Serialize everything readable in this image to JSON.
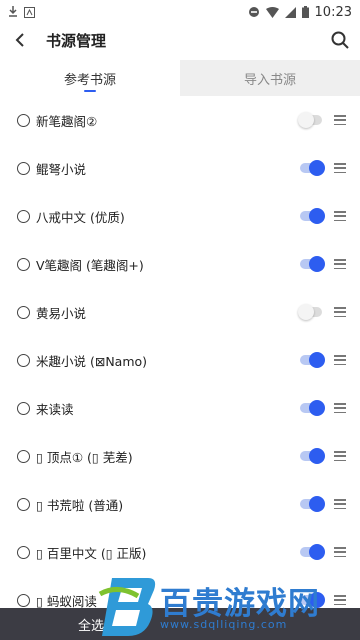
{
  "status_bar": {
    "time": "10:23"
  },
  "header": {
    "title": "书源管理"
  },
  "tabs": [
    {
      "label": "参考书源",
      "active": true
    },
    {
      "label": "导入书源",
      "active": false
    }
  ],
  "sources": [
    {
      "name": "新笔趣阁②",
      "enabled": false
    },
    {
      "name": "鲲弩小说",
      "enabled": true
    },
    {
      "name": "八戒中文 (优质)",
      "enabled": true
    },
    {
      "name": "V笔趣阁 (笔趣阁+)",
      "enabled": true
    },
    {
      "name": "黄易小说",
      "enabled": false
    },
    {
      "name": "米趣小说 (⊠Namo)",
      "enabled": true
    },
    {
      "name": "来读读",
      "enabled": true
    },
    {
      "name": "▯ 顶点① (▯ 芜差)",
      "enabled": true
    },
    {
      "name": "▯ 书荒啦 (普通)",
      "enabled": true
    },
    {
      "name": "▯ 百里中文 (▯ 正版)",
      "enabled": true
    },
    {
      "name": "▯ 蚂蚁阅读",
      "enabled": true
    }
  ],
  "bottom_bar": {
    "select_all_label": "全选"
  },
  "watermark": {
    "text": "百贵游戏网",
    "url": "www.sdqlliqing.com"
  },
  "colors": {
    "accent": "#2d5df0",
    "bottom_bar": "#3c3c44",
    "watermark": "#2f7cd0"
  }
}
